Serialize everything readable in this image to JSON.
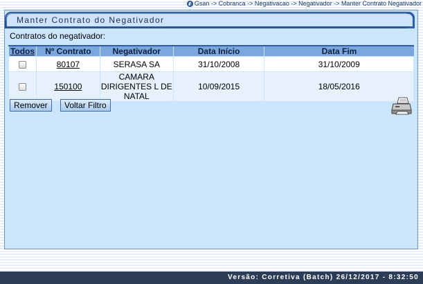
{
  "breadcrumb": {
    "text": "Gsan -> Cobranca -> Negativacao -> Negativador -> Manter Contrato Negativador"
  },
  "page": {
    "title": "Manter Contrato do Negativador",
    "section_label": "Contratos do negativador:"
  },
  "table": {
    "headers": {
      "todos": "Todos",
      "numero": "Nº Contrato",
      "negativador": "Negativador",
      "inicio": "Data Início",
      "fim": "Data Fim"
    },
    "rows": [
      {
        "numero": "80107",
        "negativador": "SERASA SA",
        "inicio": "31/10/2008",
        "fim": "31/10/2009"
      },
      {
        "numero": "150100",
        "negativador": "CAMARA DIRIGENTES L DE NATAL",
        "inicio": "10/09/2015",
        "fim": "18/05/2016"
      }
    ]
  },
  "buttons": {
    "remover": "Remover",
    "voltar": "Voltar Filtro"
  },
  "icons": {
    "breadcrumb": "help-icon",
    "print": "printer-icon"
  },
  "footer": {
    "version": "Versão: Corretiva (Batch) 26/12/2017 - 8:32:50"
  },
  "colors": {
    "panel_bg": "#cbe5fc",
    "header_bg": "#7aa8dc",
    "title_bar": "#2f5ea6",
    "footer_bg": "#2c3e57"
  }
}
